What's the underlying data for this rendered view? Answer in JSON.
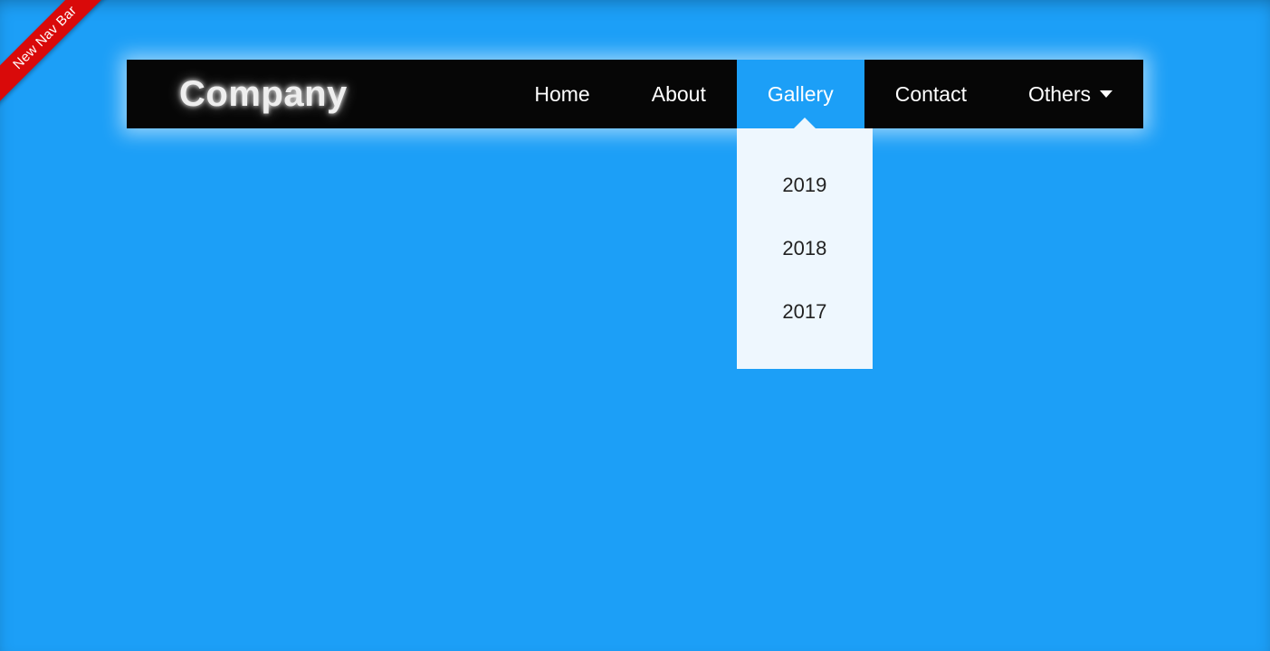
{
  "ribbon": {
    "text": "New Nav Bar"
  },
  "brand": {
    "text": "Company"
  },
  "nav": {
    "items": [
      {
        "label": "Home"
      },
      {
        "label": "About"
      },
      {
        "label": "Gallery"
      },
      {
        "label": "Contact"
      },
      {
        "label": "Others"
      }
    ],
    "active_index": 2,
    "gallery_dropdown": {
      "items": [
        {
          "label": "2019"
        },
        {
          "label": "2018"
        },
        {
          "label": "2017"
        }
      ]
    }
  }
}
